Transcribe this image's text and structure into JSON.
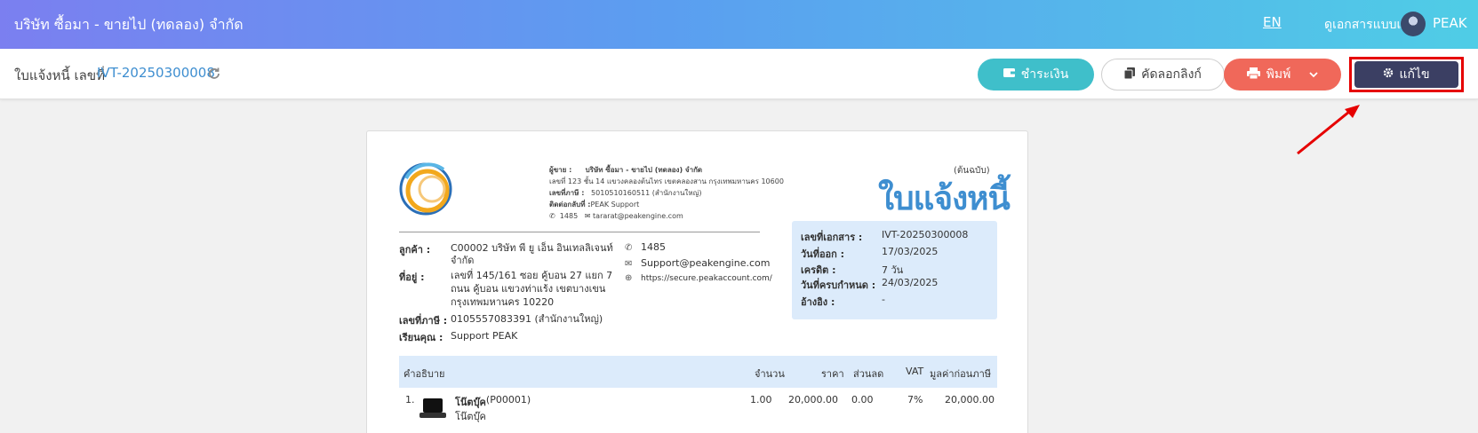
{
  "topbar": {
    "company": "บริษัท ซื้อมา - ขายไป (ทดลอง) จำกัด",
    "lang": "EN",
    "classic_link": "ดูเอกสารแบบเดิม",
    "user": "PEAK"
  },
  "subbar": {
    "doc_label": "ใบแจ้งหนี้ เลขที่",
    "doc_number": "IVT-20250300008",
    "buttons": {
      "pay": "ชำระเงิน",
      "copy_link": "คัดลอกลิงก์",
      "print": "พิมพ์",
      "edit": "แก้ไข"
    }
  },
  "colors": {
    "accent_blue": "#3e8ed0",
    "pay": "#3fbfca",
    "print": "#f0685a",
    "edit": "#3b3f63",
    "highlight": "#e60000"
  },
  "document": {
    "seller": {
      "label": "ผู้ขาย :",
      "name": "บริษัท ซื้อมา - ขายไป (ทดลอง) จำกัด",
      "address": "เลขที่ 123 ชั้น 14 แขวงคลองต้นไทร เขตคลองสาน กรุงเทพมหานคร 10600",
      "tax_label": "เลขที่ภาษี :",
      "tax_id": "5010510160511 (สำนักงานใหญ่)",
      "contact_label": "ติดต่อกลับที่ :",
      "contact_name": "PEAK Support",
      "phone": "1485",
      "email": "tararat@peakengine.com"
    },
    "original_label": "(ต้นฉบับ)",
    "title": "ใบแจ้งหนี้",
    "customer": {
      "label": "ลูกค้า :",
      "name_line1": "C00002 บริษัท พี ยู เอ็น อินเทลลิเจนท์",
      "name_line2": "จำกัด",
      "address_label": "ที่อยู่ :",
      "address_line1": "เลขที่ 145/161     ซอย คู้บอน 27 แยก 7",
      "address_line2": "ถนน คู้บอน  แขวงท่าแร้ง เขตบางเขน",
      "address_line3": "กรุงเทพมหานคร 10220",
      "tax_label": "เลขที่ภาษี :",
      "tax_id": "0105557083391 (สำนักงานใหญ่)",
      "attn_label": "เรียนคุณ :",
      "attn": "Support PEAK"
    },
    "contact": {
      "phone": "1485",
      "email": "Support@peakengine.com",
      "web": "https://secure.peakaccount.com/"
    },
    "info": {
      "doc_no_label": "เลขที่เอกสาร :",
      "doc_no": "IVT-20250300008",
      "issue_label": "วันที่ออก :",
      "issue": "17/03/2025",
      "credit_label": "เครดิต :",
      "credit": "7 วัน",
      "due_label": "วันที่ครบกำหนด :",
      "due": "24/03/2025",
      "ref_label": "อ้างอิง :",
      "ref": "-"
    },
    "table": {
      "headers": {
        "desc": "คำอธิบาย",
        "qty": "จำนวน",
        "price": "ราคา",
        "discount": "ส่วนลด",
        "vat": "VAT",
        "amount": "มูลค่าก่อนภาษี"
      },
      "rows": [
        {
          "no": "1.",
          "name": "โน๊ตบุ๊ค",
          "code": "(P00001)",
          "sub": "โน๊ตบุ๊ค",
          "qty": "1.00",
          "price": "20,000.00",
          "discount": "0.00",
          "vat": "7%",
          "amount": "20,000.00"
        }
      ]
    }
  }
}
